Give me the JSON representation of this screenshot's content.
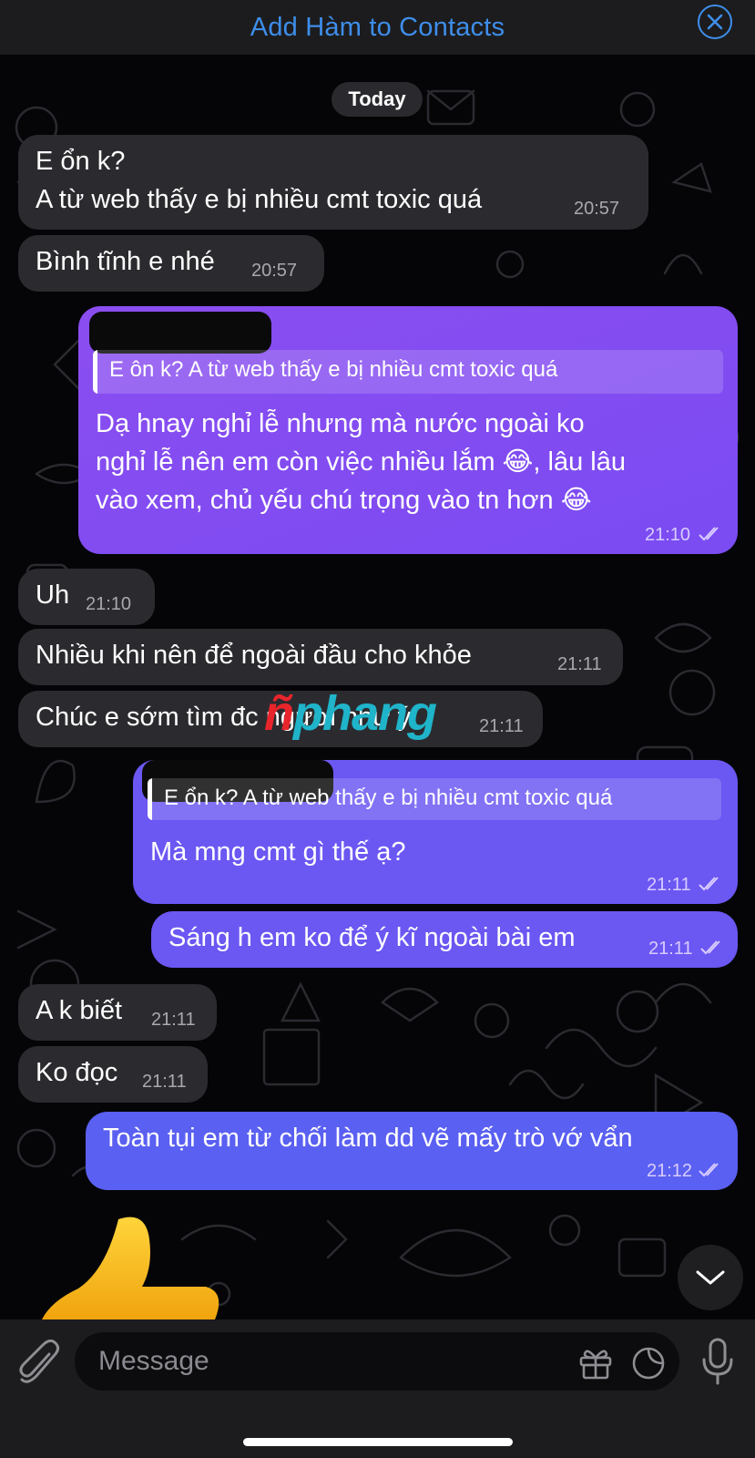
{
  "header": {
    "title": "Add Hàm to Contacts"
  },
  "date_separator": "Today",
  "messages": [
    {
      "dir": "in",
      "lines": [
        "E ổn k?",
        "A từ web thấy e bị nhiều cmt toxic quá"
      ],
      "time": "20:57"
    },
    {
      "dir": "in",
      "lines": [
        "Bình tĩnh e nhé"
      ],
      "time": "20:57"
    },
    {
      "dir": "out",
      "reply": "E ôn k? A từ web thấy e bị nhiều cmt toxic quá",
      "lines": [
        "Dạ hnay nghỉ lễ nhưng mà nước ngoài ko",
        "nghỉ lễ nên em còn việc nhiều lắm 😂, lâu lâu",
        "vào xem, chủ yếu chú trọng vào tn hơn 😂"
      ],
      "time": "21:10"
    },
    {
      "dir": "in",
      "lines": [
        "Uh"
      ],
      "time": "21:10"
    },
    {
      "dir": "in",
      "lines": [
        "Nhiều khi nên để ngoài đầu cho khỏe"
      ],
      "time": "21:11"
    },
    {
      "dir": "in",
      "lines": [
        "Chúc e sớm tìm đc người như ý"
      ],
      "time": "21:11"
    },
    {
      "dir": "out",
      "reply": "E ổn k? A từ web thấy e bị nhiều cmt toxic quá",
      "lines": [
        "Mà mng cmt gì thế ạ?"
      ],
      "time": "21:11"
    },
    {
      "dir": "out",
      "lines": [
        "Sáng h em ko để ý kĩ ngoài bài em"
      ],
      "time": "21:11"
    },
    {
      "dir": "in",
      "lines": [
        "A k biết"
      ],
      "time": "21:11"
    },
    {
      "dir": "in",
      "lines": [
        "Ko đọc"
      ],
      "time": "21:11"
    },
    {
      "dir": "out",
      "lines": [
        "Toàn tụi em từ chối làm dd vẽ mấy trò vớ vẩn"
      ],
      "time": "21:12"
    }
  ],
  "watermark": {
    "part1": "ñ",
    "part2": "phang"
  },
  "input": {
    "placeholder": "Message"
  },
  "colors": {
    "accent": "#3e8eea",
    "incoming": "#2b2b2f",
    "outgoing": "#7a4cf2"
  }
}
